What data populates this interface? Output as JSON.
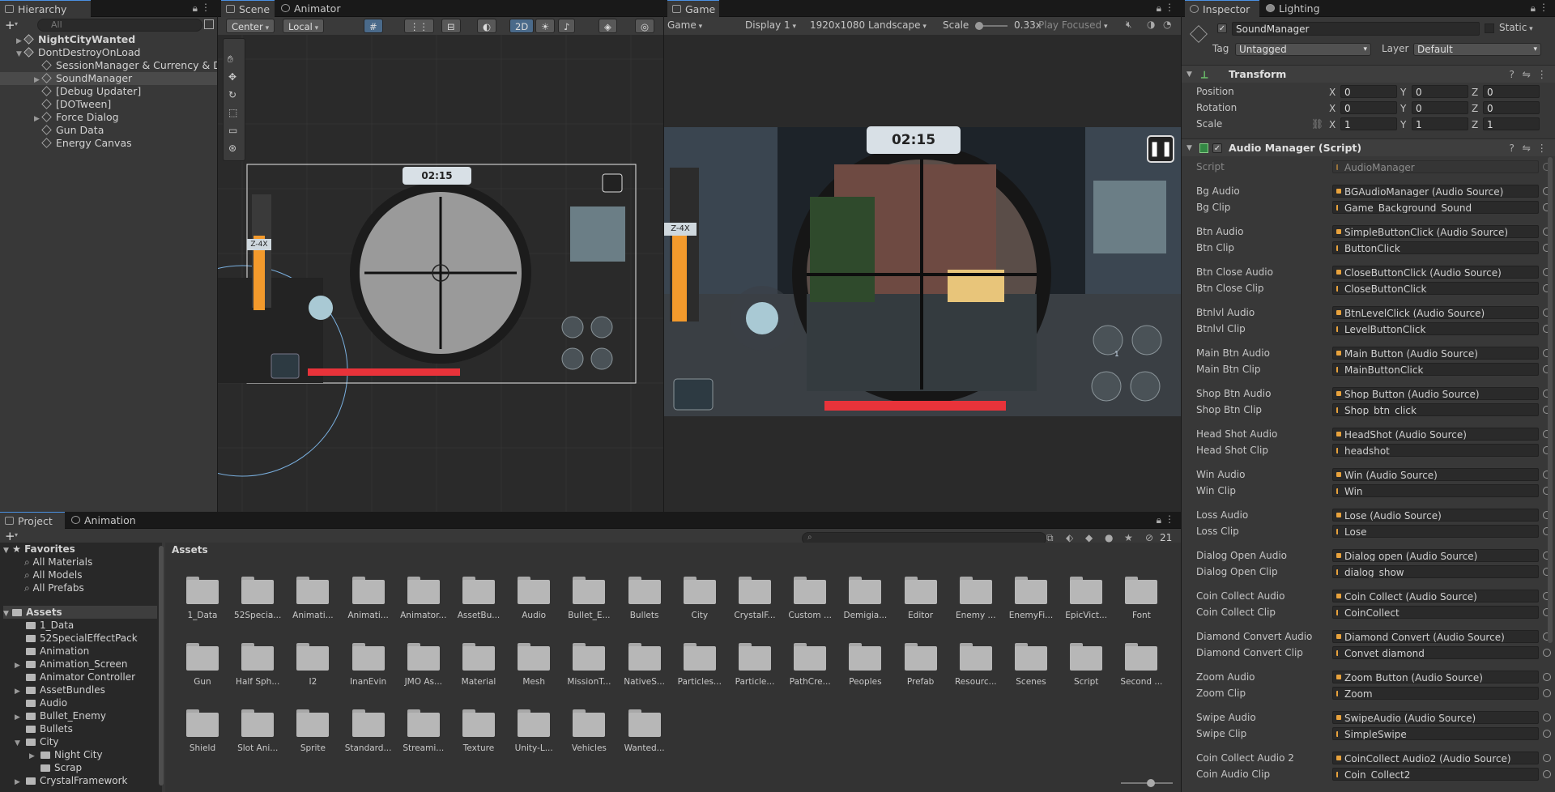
{
  "hierarchy": {
    "tab": "Hierarchy",
    "search_placeholder": "All",
    "items": [
      {
        "label": "NightCityWanted",
        "bold": true,
        "expanded": false
      },
      {
        "label": "DontDestroyOnLoad",
        "expanded": true
      },
      {
        "label": "SessionManager & Currency & Da"
      },
      {
        "label": "SoundManager",
        "selected": true
      },
      {
        "label": "[Debug Updater]"
      },
      {
        "label": "[DOTween]"
      },
      {
        "label": "Force Dialog"
      },
      {
        "label": "Gun Data"
      },
      {
        "label": "Energy Canvas"
      }
    ]
  },
  "scene": {
    "tabs": [
      "Scene",
      "Animator"
    ],
    "pivot": "Center",
    "space": "Local",
    "mode_2d": "2D",
    "timer": "02:15",
    "zoom": "Z-4X"
  },
  "game": {
    "tab": "Game",
    "display_type": "Game",
    "display": "Display 1",
    "resolution": "1920x1080 Landscape",
    "scale_label": "Scale",
    "scale_value": "0.33x",
    "play_mode": "Play Focused",
    "timer": "02:15",
    "zoom": "Z-4X",
    "badge": "1"
  },
  "inspector": {
    "tabs": [
      "Inspector",
      "Lighting"
    ],
    "object_name": "SoundManager",
    "static_label": "Static",
    "tag_label": "Tag",
    "tag_value": "Untagged",
    "layer_label": "Layer",
    "layer_value": "Default",
    "transform": {
      "title": "Transform",
      "rows": [
        {
          "label": "Position",
          "x": "0",
          "y": "0",
          "z": "0"
        },
        {
          "label": "Rotation",
          "x": "0",
          "y": "0",
          "z": "0"
        },
        {
          "label": "Scale",
          "x": "1",
          "y": "1",
          "z": "1"
        }
      ]
    },
    "script_component": {
      "title": "Audio Manager (Script)",
      "script_label": "Script",
      "script_value": "AudioManager",
      "groups": [
        [
          {
            "label": "Bg Audio",
            "value": "BGAudioManager (Audio Source)"
          },
          {
            "label": "Bg Clip",
            "value": "Game_Background_Sound"
          }
        ],
        [
          {
            "label": "Btn Audio",
            "value": "SimpleButtonClick (Audio Source)"
          },
          {
            "label": "Btn Clip",
            "value": "ButtonClick"
          }
        ],
        [
          {
            "label": "Btn Close Audio",
            "value": "CloseButtonClick (Audio Source)"
          },
          {
            "label": "Btn Close Clip",
            "value": "CloseButtonClick"
          }
        ],
        [
          {
            "label": "Btnlvl Audio",
            "value": "BtnLevelClick (Audio Source)"
          },
          {
            "label": "Btnlvl Clip",
            "value": "LevelButtonClick"
          }
        ],
        [
          {
            "label": "Main Btn Audio",
            "value": "Main Button (Audio Source)"
          },
          {
            "label": "Main Btn Clip",
            "value": "MainButtonClick"
          }
        ],
        [
          {
            "label": "Shop Btn Audio",
            "value": "Shop Button (Audio Source)"
          },
          {
            "label": "Shop Btn Clip",
            "value": "Shop_btn_click"
          }
        ],
        [
          {
            "label": "Head Shot Audio",
            "value": "HeadShot (Audio Source)"
          },
          {
            "label": "Head Shot Clip",
            "value": "headshot"
          }
        ],
        [
          {
            "label": "Win Audio",
            "value": "Win (Audio Source)"
          },
          {
            "label": "Win Clip",
            "value": "Win"
          }
        ],
        [
          {
            "label": "Loss Audio",
            "value": "Lose (Audio Source)"
          },
          {
            "label": "Loss Clip",
            "value": "Lose"
          }
        ],
        [
          {
            "label": "Dialog Open Audio",
            "value": "Dialog open (Audio Source)"
          },
          {
            "label": "Dialog Open Clip",
            "value": "dialog_show"
          }
        ],
        [
          {
            "label": "Coin Collect Audio",
            "value": "Coin Collect (Audio Source)"
          },
          {
            "label": "Coin Collect Clip",
            "value": "CoinCollect"
          }
        ],
        [
          {
            "label": "Diamond Convert Audio",
            "value": "Diamond Convert (Audio Source)"
          },
          {
            "label": "Diamond Convert Clip",
            "value": "Convet diamond"
          }
        ],
        [
          {
            "label": "Zoom Audio",
            "value": "Zoom Button (Audio Source)"
          },
          {
            "label": "Zoom Clip",
            "value": "Zoom"
          }
        ],
        [
          {
            "label": "Swipe Audio",
            "value": "SwipeAudio (Audio Source)"
          },
          {
            "label": "Swipe Clip",
            "value": "SimpleSwipe"
          }
        ],
        [
          {
            "label": "Coin Collect Audio 2",
            "value": "CoinCollect Audio2 (Audio Source)"
          },
          {
            "label": "Coin Audio Clip",
            "value": "Coin_Collect2"
          }
        ]
      ]
    }
  },
  "project": {
    "tabs": [
      "Project",
      "Animation"
    ],
    "hidden_count": "21",
    "favorites": {
      "label": "Favorites",
      "items": [
        "All Materials",
        "All Models",
        "All Prefabs"
      ]
    },
    "assets_label": "Assets",
    "tree": [
      {
        "label": "1_Data",
        "depth": 1
      },
      {
        "label": "52SpecialEffectPack",
        "depth": 1
      },
      {
        "label": "Animation",
        "depth": 1
      },
      {
        "label": "Animation_Screen",
        "depth": 1,
        "arrow": true
      },
      {
        "label": "Animator Controller",
        "depth": 1
      },
      {
        "label": "AssetBundles",
        "depth": 1,
        "arrow": true
      },
      {
        "label": "Audio",
        "depth": 1
      },
      {
        "label": "Bullet_Enemy",
        "depth": 1,
        "arrow": true
      },
      {
        "label": "Bullets",
        "depth": 1
      },
      {
        "label": "City",
        "depth": 1,
        "arrow": true,
        "open": true
      },
      {
        "label": "Night City",
        "depth": 2,
        "arrow": true
      },
      {
        "label": "Scrap",
        "depth": 2
      },
      {
        "label": "CrystalFramework",
        "depth": 1,
        "arrow": true
      }
    ],
    "breadcrumb": "Assets",
    "folders": [
      "1_Data",
      "52Specia...",
      "Animati...",
      "Animati...",
      "Animator...",
      "AssetBu...",
      "Audio",
      "Bullet_E...",
      "Bullets",
      "City",
      "CrystalF...",
      "Custom ...",
      "Demigia...",
      "Editor",
      "Enemy ...",
      "EnemyFi...",
      "EpicVict...",
      "Font",
      "Gun",
      "Half Sph...",
      "I2",
      "InanEvin",
      "JMO As...",
      "Material",
      "Mesh",
      "MissionT...",
      "NativeS...",
      "Particles...",
      "Particle...",
      "PathCre...",
      "Peoples",
      "Prefab",
      "Resourc...",
      "Scenes",
      "Script",
      "Second ...",
      "Shield",
      "Slot Ani...",
      "Sprite",
      "Standard...",
      "Streami...",
      "Texture",
      "Unity-L...",
      "Vehicles",
      "Wanted..."
    ]
  },
  "colors": {
    "accent": "#4a90e2",
    "health": "#e8333a",
    "energy": "#f39a2c",
    "selection": "#2c5d87"
  }
}
